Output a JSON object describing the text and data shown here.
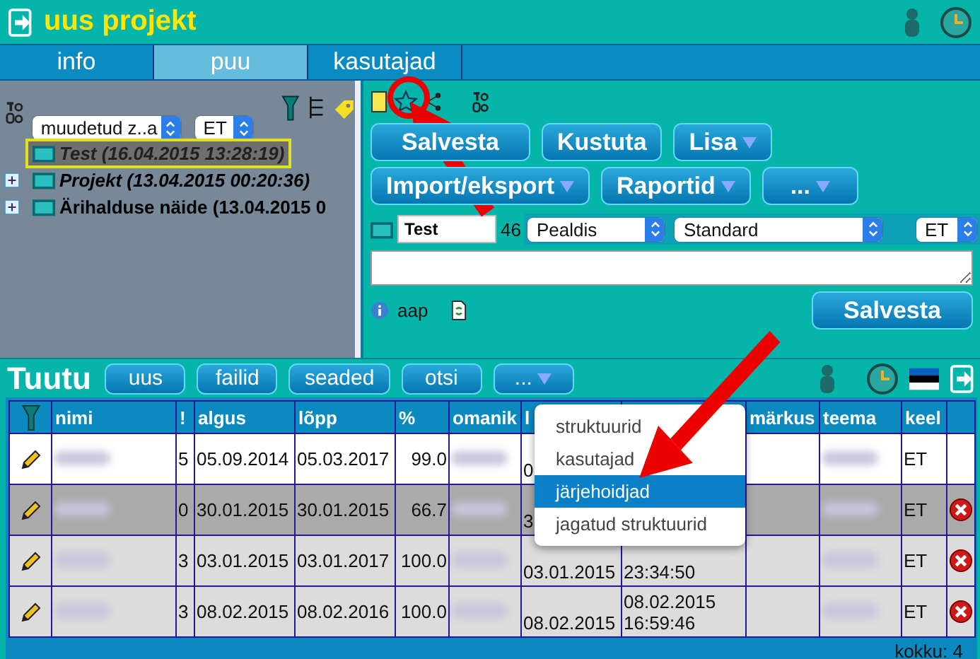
{
  "header": {
    "title": "uus projekt"
  },
  "tabs": [
    {
      "label": "info",
      "selected": false
    },
    {
      "label": "puu",
      "selected": true
    },
    {
      "label": "kasutajad",
      "selected": false
    }
  ],
  "tree_panel": {
    "sort_select": "muudetud z..a",
    "language_select": "ET",
    "items": [
      {
        "label": "Test (16.04.2015 13:28:19)",
        "selected": true,
        "emphasized": true
      },
      {
        "label": "Projekt (13.04.2015 00:20:36)",
        "selected": false,
        "emphasized": true,
        "expanded": false
      },
      {
        "label": "Ärihalduse näide (13.04.2015 0",
        "selected": false,
        "emphasized": false,
        "expanded": false
      }
    ]
  },
  "editor": {
    "buttons": [
      [
        {
          "label": "Salvesta",
          "dropdown": false
        },
        {
          "label": "Kustuta",
          "dropdown": false
        },
        {
          "label": "Lisa",
          "dropdown": true
        }
      ],
      [
        {
          "label": "Import/eksport",
          "dropdown": true
        },
        {
          "label": "Raportid",
          "dropdown": true
        },
        {
          "label": "...",
          "dropdown": true
        }
      ]
    ],
    "name_field": "Test",
    "count": "46",
    "type_select": "Pealdis",
    "style_select": "Standard",
    "language_select": "ET",
    "author": "aap",
    "save_button": "Salvesta"
  },
  "list_panel": {
    "title": "Tuutu",
    "buttons": [
      {
        "label": "uus",
        "dropdown": false
      },
      {
        "label": "failid",
        "dropdown": false
      },
      {
        "label": "seaded",
        "dropdown": false
      },
      {
        "label": "otsi",
        "dropdown": false
      },
      {
        "label": "...",
        "dropdown": true
      }
    ],
    "menu": [
      {
        "label": "struktuurid",
        "selected": false
      },
      {
        "label": "kasutajad",
        "selected": false
      },
      {
        "label": "järjehoidjad",
        "selected": true
      },
      {
        "label": "jagatud struktuurid",
        "selected": false
      }
    ],
    "table": {
      "columns": [
        {
          "label": "nimi"
        },
        {
          "label": "!"
        },
        {
          "label": "algus"
        },
        {
          "label": "lõpp"
        },
        {
          "label": "%"
        },
        {
          "label": "omanik"
        },
        {
          "label": "l"
        },
        {},
        {
          "label": "märkus"
        },
        {
          "label": "teema"
        },
        {
          "label": "keel"
        }
      ],
      "rows": [
        {
          "color": "#ffffff",
          "deletable": false,
          "cells": [
            {
              "kind": "blurred"
            },
            {
              "kind": "text",
              "text": "5"
            },
            {
              "kind": "text",
              "text": "05.09.2014"
            },
            {
              "kind": "text",
              "text": "05.03.2017"
            },
            {
              "kind": "text",
              "text": "99.0"
            },
            {
              "kind": "blurred"
            },
            {
              "kind": "text",
              "text": "0"
            },
            {
              "kind": "empty"
            },
            {
              "kind": "empty"
            },
            {
              "kind": "blurred"
            },
            {
              "kind": "text",
              "text": "ET"
            }
          ]
        },
        {
          "color": "#aaaaaa",
          "deletable": true,
          "cells": [
            {
              "kind": "blurred"
            },
            {
              "kind": "text",
              "text": "0"
            },
            {
              "kind": "text",
              "text": "30.01.2015"
            },
            {
              "kind": "text",
              "text": "30.01.2015"
            },
            {
              "kind": "text",
              "text": "66.7"
            },
            {
              "kind": "blurred"
            },
            {
              "kind": "text",
              "text": "3"
            },
            {
              "kind": "empty"
            },
            {
              "kind": "empty"
            },
            {
              "kind": "blurred"
            },
            {
              "kind": "text",
              "text": "ET"
            }
          ]
        },
        {
          "color": "#dcdcdc",
          "deletable": true,
          "cells": [
            {
              "kind": "blurred"
            },
            {
              "kind": "text",
              "text": "3"
            },
            {
              "kind": "text",
              "text": "03.01.2015"
            },
            {
              "kind": "text",
              "text": "03.01.2017"
            },
            {
              "kind": "text",
              "text": "100.0"
            },
            {
              "kind": "blurred"
            },
            {
              "kind": "text",
              "text": "03.01.2015"
            },
            {
              "kind": "text",
              "text": "23:34:50"
            },
            {
              "kind": "empty"
            },
            {
              "kind": "blurred"
            },
            {
              "kind": "text",
              "text": "ET"
            }
          ]
        },
        {
          "color": "#dcdcdc",
          "deletable": true,
          "cells": [
            {
              "kind": "blurred"
            },
            {
              "kind": "text",
              "text": "3"
            },
            {
              "kind": "text",
              "text": "08.02.2015"
            },
            {
              "kind": "text",
              "text": "08.02.2016"
            },
            {
              "kind": "text",
              "text": "100.0"
            },
            {
              "kind": "blurred"
            },
            {
              "kind": "text",
              "text": "08.02.2015"
            },
            {
              "kind": "text",
              "text": "08.02.2015 16:59:46"
            },
            {
              "kind": "empty"
            },
            {
              "kind": "blurred"
            },
            {
              "kind": "text",
              "text": "ET"
            }
          ]
        }
      ]
    },
    "total": "kokku: 4"
  }
}
